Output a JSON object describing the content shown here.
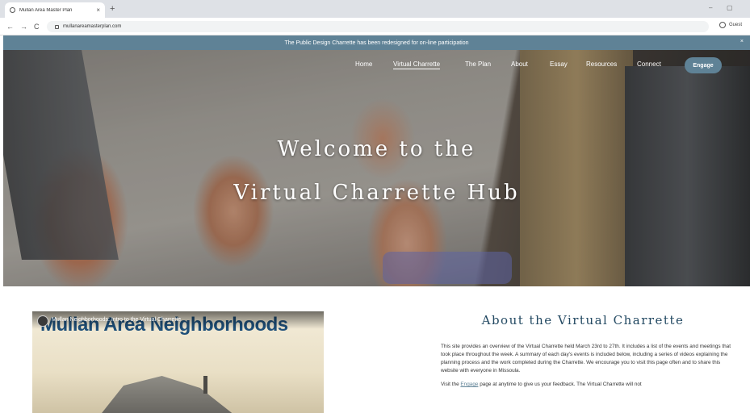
{
  "browser": {
    "tab_title": "Mullan Area Master Plan",
    "tab_close": "×",
    "new_tab": "+",
    "url": "mullanareamasterplan.com",
    "profile": "Guest",
    "back": "←",
    "forward": "→",
    "reload": "C",
    "minimize": "–",
    "maximize": "▢"
  },
  "announcement": {
    "text": "The Public Design Charrette has been redesigned for on-line participation",
    "close": "×"
  },
  "nav": {
    "items": [
      {
        "label": "Home"
      },
      {
        "label": "Virtual Charrette"
      },
      {
        "label": "The Plan"
      },
      {
        "label": "About"
      },
      {
        "label": "Essay"
      },
      {
        "label": "Resources"
      },
      {
        "label": "Connect"
      }
    ],
    "cta": "Engage"
  },
  "hero": {
    "line1": "Welcome to the",
    "line2": "Virtual Charrette Hub"
  },
  "video": {
    "caption": "Mullan Neighborhoods: Intro to the Virtual Charrette",
    "title_overlay": "Mullan Area Neighborhoods",
    "share_icon": "➦"
  },
  "about": {
    "title": "About the Virtual Charrette",
    "p1": "This site provides an overview of the Virtual Charrette held March 23rd to 27th.  It includes a list of the events and meetings that took place throughout the week.  A summary of each day's events is included below, including a series of videos explaining the planning process and the work completed during the Charrette.  We encourage you to visit this page often and to share this website with everyone in Missoula.",
    "p2_pre": "Visit the ",
    "p2_link": "Engage",
    "p2_post": " page at anytime to give us your feedback. The Virtual Charrette will not"
  },
  "colors": {
    "accent": "#5f8296",
    "heading": "#244a63",
    "video_title": "#1e4f79"
  }
}
